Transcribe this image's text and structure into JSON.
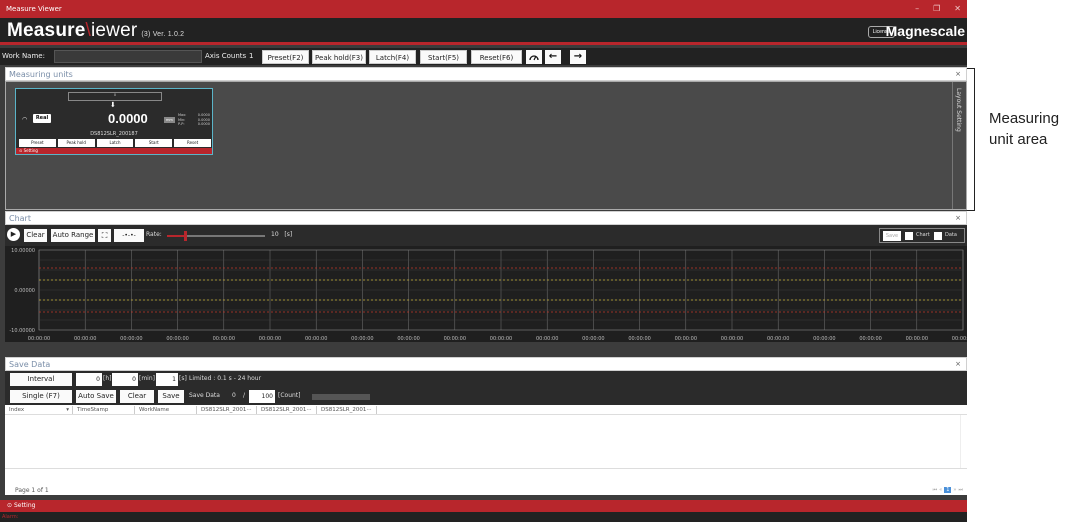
{
  "window": {
    "title": "Measure Viewer",
    "minimize": "–",
    "restore": "❐",
    "close": "✕"
  },
  "brand": {
    "app_name_bold": "Measure",
    "app_name_slash": "\\",
    "app_name_rest": "iewer",
    "version": "(3) Ver. 1.0.2",
    "license_label": "License",
    "maker": "Magnescale"
  },
  "toolbar": {
    "work_name_label": "Work Name:",
    "work_name_value": "",
    "axis_counts_label": "Axis Counts",
    "axis_counts_value": "1",
    "preset": "Preset(F2)",
    "peak_hold": "Peak hold(F3)",
    "latch": "Latch(F4)",
    "start": "Start(F5)",
    "reset": "Reset(F6)",
    "gauge_icon": "gauge-icon",
    "back_icon": "arrow-left-icon",
    "forward_icon": "arrow-right-icon"
  },
  "measuring_units": {
    "title": "Measuring units",
    "close": "×",
    "layout_setting": "Layout Setting",
    "card": {
      "indicator_value": "0",
      "mode": "Real",
      "value": "0.0000",
      "unit": "mm",
      "stats": [
        {
          "label": "Max:",
          "value": "0.0000"
        },
        {
          "label": "Min:",
          "value": "0.0000"
        },
        {
          "label": "P-P:",
          "value": "0.0000"
        }
      ],
      "serial": "DS812SLR_200187",
      "buttons": [
        "Preset",
        "Peak hold",
        "Latch",
        "Start",
        "Reset"
      ],
      "setting": "Setting"
    }
  },
  "chart": {
    "title": "Chart",
    "close": "×",
    "clear": "Clear",
    "auto_range": "Auto Range",
    "rate_label": "Rate:",
    "rate_value": "10",
    "rate_unit": "[s]",
    "rate_fraction": 0.18,
    "save": "Save",
    "chart_chk": "Chart",
    "data_chk": "Data"
  },
  "chart_data": {
    "type": "line",
    "yticks": [
      "10.00000",
      "0.00000",
      "-10.00000"
    ],
    "ylim": [
      -10,
      10
    ],
    "xticks": [
      "00:00:00",
      "00:00:00",
      "00:00:00",
      "00:00:00",
      "00:00:00",
      "00:00:00",
      "00:00:00",
      "00:00:00",
      "00:00:00",
      "00:00:00",
      "00:00:00",
      "00:00:00",
      "00:00:00",
      "00:00:00",
      "00:00:00",
      "00:00:00",
      "00:00:00",
      "00:00:00",
      "00:00:00",
      "00:00:00",
      "00:00:00"
    ],
    "grid": true,
    "reference_lines": [
      {
        "value": 5.5,
        "color": "#c0392b"
      },
      {
        "value": 2.5,
        "color": "#c9b13a"
      },
      {
        "value": -2.5,
        "color": "#c9b13a"
      },
      {
        "value": -5.5,
        "color": "#c0392b"
      }
    ],
    "series": []
  },
  "save_data": {
    "title": "Save Data",
    "close": "×",
    "interval": "Interval",
    "h_value": "0",
    "h_unit": "[h]",
    "min_value": "0",
    "min_unit": "[min]",
    "s_value": "1",
    "s_unit": "[s]",
    "limit_text": "Limited : 0.1 s - 24 hour",
    "single": "Single (F7)",
    "auto_save": "Auto Save",
    "clear": "Clear",
    "save": "Save",
    "save_data_label": "Save Data",
    "saved_count": "0",
    "count_sep": "/",
    "count_total": "100",
    "count_unit": "[Count]",
    "progress": 0,
    "columns": [
      "Index",
      "TimeStamp",
      "WorkName",
      "DS812SLR_2001···",
      "DS812SLR_2001···",
      "DS812SLR_2001···"
    ],
    "page_info": "Page 1 of 1",
    "pager": [
      "⏮",
      "«",
      "1",
      "»",
      "⏭"
    ]
  },
  "status": {
    "setting": "Setting",
    "alarm": "Alarm:"
  },
  "callout": {
    "line1": "Measuring",
    "line2": "unit area"
  }
}
